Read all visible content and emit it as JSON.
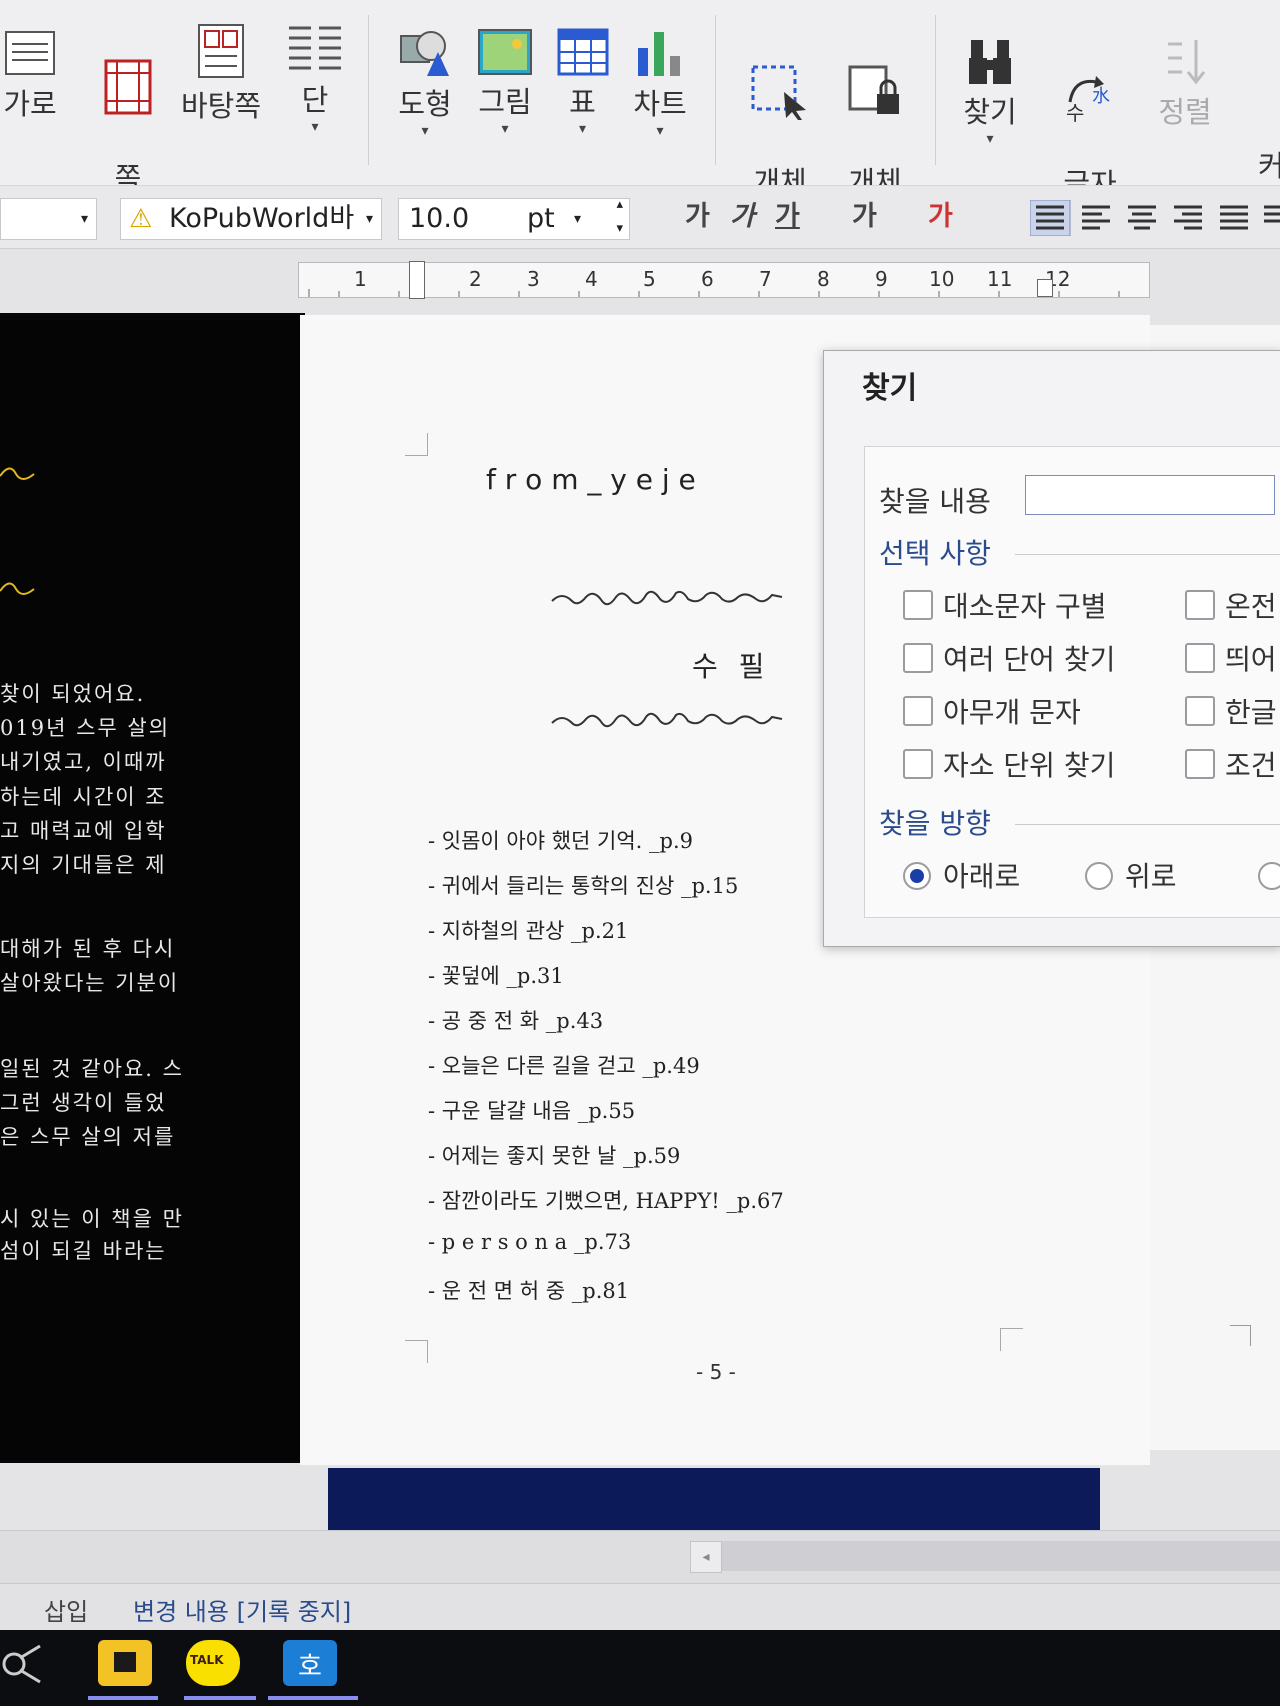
{
  "ribbon": {
    "groups": [
      {
        "label": "가로"
      },
      {
        "label": "쪽\n여백"
      },
      {
        "label": "바탕쪽"
      },
      {
        "label": "단"
      },
      {
        "label": "도형"
      },
      {
        "label": "그림"
      },
      {
        "label": "표"
      },
      {
        "label": "차트"
      },
      {
        "label": "개체\n선택"
      },
      {
        "label": "개체\n보호"
      },
      {
        "label": "찾기"
      },
      {
        "label": "글자\n바꾸기"
      },
      {
        "label": "정렬"
      }
    ],
    "edge_label": "커"
  },
  "format_bar": {
    "font_name": "KoPubWorld바",
    "font_size": "10.0",
    "unit": "pt",
    "style_buttons": [
      "가",
      "가",
      "가",
      "가",
      "가"
    ]
  },
  "ruler": {
    "ticks": [
      "1",
      "1",
      "2",
      "3",
      "4",
      "5",
      "6",
      "7",
      "8",
      "9",
      "10",
      "11",
      "12"
    ]
  },
  "left_page": {
    "lines": [
      "찾이 되었어요.",
      "019년 스무 살의",
      "내기였고, 이때까",
      "하는데 시간이 조",
      "고 매력교에 입학",
      "지의 기대들은 제",
      "대해가 된 후 다시",
      "살아왔다는 기분이",
      "일된 것 같아요. 스",
      "그런 생각이 들었",
      "은 스무 살의 저를",
      "시 있는 이 책을 만",
      "섬이 되길 바라는"
    ]
  },
  "document": {
    "header": "f r o m _ y e j e",
    "section_title": "수 필",
    "toc": [
      "- 잇몸이 아야 했던 기억. _p.9",
      "- 귀에서 들리는 통학의 진상 _p.15",
      "- 지하철의 관상 _p.21",
      "- 꽃덮에 _p.31",
      "- 공 중 전 화 _p.43",
      "- 오늘은 다른 길을 걷고 _p.49",
      "- 구운 달걀 내음 _p.55",
      "- 어제는 좋지 못한 날 _p.59",
      "- 잠깐이라도 기뻤으면, HAPPY! _p.67",
      "- p e r s o n a _p.73",
      "- 운 전 면 허 중 _p.81"
    ],
    "page_number": "- 5 -"
  },
  "find_dialog": {
    "title": "찾기",
    "find_label": "찾을 내용",
    "find_value": "",
    "options_heading": "선택 사항",
    "options_left": [
      "대소문자 구별",
      "여러 단어 찾기",
      "아무개 문자",
      "자소 단위 찾기"
    ],
    "options_right": [
      "온전",
      "띄어",
      "한글",
      "조건"
    ],
    "direction_heading": "찾을 방향",
    "directions": [
      "아래로",
      "위로"
    ],
    "selected_direction": "아래로"
  },
  "status_bar": {
    "mode": "삽입",
    "track_changes": "변경 내용 [기록 중지]"
  },
  "taskbar": {
    "kakao_label": "TALK",
    "hwp_label": "호"
  },
  "colors": {
    "accent_blue": "#2b4c8c",
    "navy_band": "#0d1a5a",
    "taskbar": "#0c0d10"
  }
}
